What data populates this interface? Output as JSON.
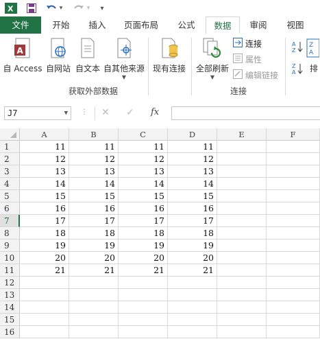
{
  "qat": {
    "excel_icon": "excel-logo-icon",
    "save": "save-icon",
    "undo": "undo-icon",
    "redo": "redo-icon",
    "customize": "▾"
  },
  "tabs": [
    {
      "label": "文件"
    },
    {
      "label": "开始"
    },
    {
      "label": "插入"
    },
    {
      "label": "页面布局"
    },
    {
      "label": "公式"
    },
    {
      "label": "数据"
    },
    {
      "label": "审阅"
    },
    {
      "label": "视图"
    }
  ],
  "active_tab": "数据",
  "ribbon": {
    "get_external": {
      "group_label": "获取外部数据",
      "buttons": [
        {
          "label": "自 Access",
          "icon": "access-db-icon"
        },
        {
          "label": "自网站",
          "icon": "web-globe-icon"
        },
        {
          "label": "自文本",
          "icon": "text-file-icon"
        },
        {
          "label": "自其他来源",
          "icon": "other-sources-icon"
        }
      ]
    },
    "existing": {
      "label": "现有连接",
      "icon": "existing-connections-icon"
    },
    "connections": {
      "group_label": "连接",
      "refresh": {
        "label": "全部刷新",
        "icon": "refresh-all-icon"
      },
      "items": [
        {
          "label": "连接",
          "enabled": true
        },
        {
          "label": "属性",
          "enabled": false
        },
        {
          "label": "编辑链接",
          "enabled": false
        }
      ]
    },
    "sort": {
      "label": "排",
      "asc_icon": "sort-asc-icon",
      "desc_icon": "sort-desc-icon"
    }
  },
  "formula_bar": {
    "name_box": "J7",
    "fx": "fx",
    "value": ""
  },
  "columns": [
    "A",
    "B",
    "C",
    "D",
    "E",
    "F"
  ],
  "rows": [
    {
      "n": "1",
      "cells": [
        "11",
        "11",
        "11",
        "11"
      ]
    },
    {
      "n": "2",
      "cells": [
        "12",
        "12",
        "12",
        "12"
      ]
    },
    {
      "n": "3",
      "cells": [
        "13",
        "13",
        "13",
        "13"
      ]
    },
    {
      "n": "4",
      "cells": [
        "14",
        "14",
        "14",
        "14"
      ]
    },
    {
      "n": "5",
      "cells": [
        "15",
        "15",
        "15",
        "15"
      ]
    },
    {
      "n": "6",
      "cells": [
        "16",
        "16",
        "16",
        "16"
      ]
    },
    {
      "n": "7",
      "cells": [
        "17",
        "17",
        "17",
        "17"
      ]
    },
    {
      "n": "8",
      "cells": [
        "18",
        "18",
        "18",
        "18"
      ]
    },
    {
      "n": "9",
      "cells": [
        "19",
        "19",
        "19",
        "19"
      ]
    },
    {
      "n": "10",
      "cells": [
        "20",
        "20",
        "20",
        "20"
      ]
    },
    {
      "n": "11",
      "cells": [
        "21",
        "21",
        "21",
        "21"
      ]
    },
    {
      "n": "12",
      "cells": [
        "",
        "",
        "",
        ""
      ]
    },
    {
      "n": "13",
      "cells": [
        "",
        "",
        "",
        ""
      ]
    },
    {
      "n": "14",
      "cells": [
        "",
        "",
        "",
        ""
      ]
    },
    {
      "n": "15",
      "cells": [
        "",
        "",
        "",
        ""
      ]
    },
    {
      "n": "16",
      "cells": [
        "",
        "",
        "",
        ""
      ]
    }
  ],
  "selected_row": "7",
  "colors": {
    "accent": "#217346",
    "disabled": "#9a9a9a"
  }
}
